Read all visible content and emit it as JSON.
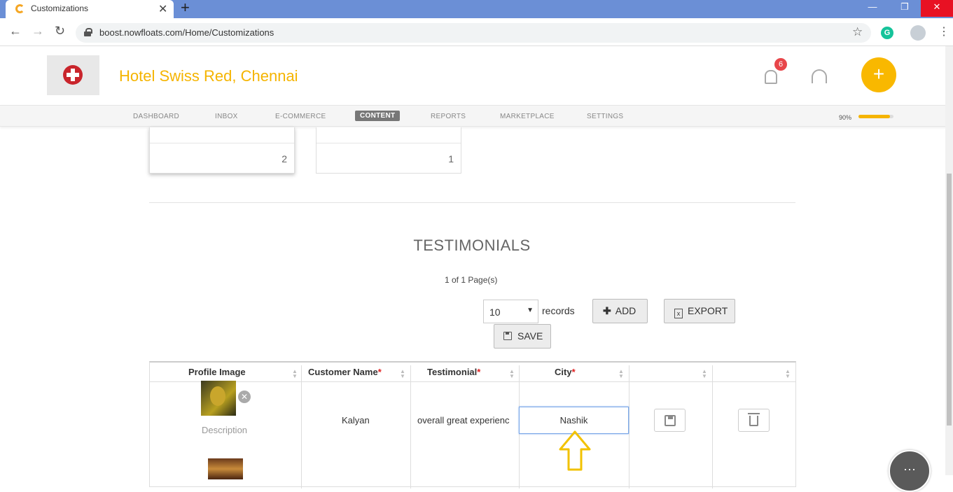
{
  "browser": {
    "tab_title": "Customizations",
    "url": "boost.nowfloats.com/Home/Customizations",
    "new_tab": "+",
    "tab_close": "✕",
    "ext_label": "G"
  },
  "header": {
    "hotel_name": "Hotel Swiss Red, Chennai",
    "notification_count": "6",
    "add_label": "+"
  },
  "menu": {
    "items": [
      "DASHBOARD",
      "INBOX",
      "E-COMMERCE",
      "CONTENT",
      "REPORTS",
      "MARKETPLACE",
      "SETTINGS"
    ],
    "active": "CONTENT",
    "progress_label": "90%",
    "progress_value": 0.9
  },
  "cards": [
    {
      "count": "2"
    },
    {
      "count": "1"
    }
  ],
  "testimonials": {
    "title": "TESTIMONIALS",
    "pager": "1 of 1 Page(s)",
    "records_value": "10",
    "records_label": "records",
    "add_label": "ADD",
    "export_label": "EXPORT",
    "save_label": "SAVE",
    "columns": [
      "Profile Image",
      "Customer Name",
      "Testimonial",
      "City"
    ],
    "rows": [
      {
        "description": "Description",
        "customer_name": "Kalyan",
        "testimonial": "overall great experienc",
        "city": "Nashik"
      }
    ]
  },
  "colors": {
    "brand_yellow": "#f5b400",
    "tab_bar": "#6b8fd6",
    "required": "#e02020"
  },
  "icons": [
    "search-icon",
    "lock-icon",
    "star-icon",
    "bell-icon",
    "headset-icon",
    "plus-icon",
    "excel-icon",
    "save-icon",
    "trash-icon",
    "chat-icon",
    "arrow-up-icon"
  ]
}
